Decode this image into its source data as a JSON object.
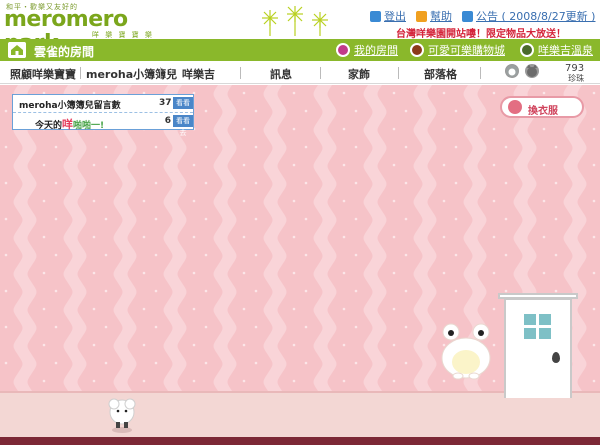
{
  "header": {
    "tagline": "和平・歡樂又友好的",
    "brand": "meromero park",
    "brand_sub": "咩 樂 寶 寶 樂 園",
    "links": [
      {
        "label": "登出",
        "icon": "logout-icon",
        "color": "#3a8ad4"
      },
      {
        "label": "幫助",
        "icon": "help-icon",
        "color": "#f0a020"
      },
      {
        "label": "公告 ( 2008/8/27更新 )",
        "icon": "notice-icon",
        "color": "#3a8ad4"
      }
    ],
    "promo": "台灣咩樂園開站嘍！限定物品大放送！"
  },
  "greenbar": {
    "title": "雲雀的房間",
    "links": [
      {
        "label": "我的房間",
        "icon": "my-room-icon",
        "color": "#c23a8a"
      },
      {
        "label": "可愛可樂購物城",
        "icon": "shopping-icon",
        "color": "#8b3a1a"
      },
      {
        "label": "咩樂吉溫泉",
        "icon": "hot-spring-icon",
        "color": "#4a6a2a"
      }
    ]
  },
  "nav": {
    "items": [
      "照顧咩樂寶寶",
      "meroha小簿簿兒",
      "咩樂吉",
      "訊息",
      "家飾",
      "部落格"
    ],
    "coins_value": "793",
    "coins_label": "珍珠"
  },
  "infobox": {
    "row1_label": "meroha小簿簿兒留言數",
    "row1_value": "37",
    "row1_button": "看看去",
    "row2_prefix": "今天的",
    "row2_highlight": "咩",
    "row2_suffix": "啪啪一!",
    "row2_value": "6",
    "row2_button": "看看去"
  },
  "wardrobe_button": "換衣服",
  "colors": {
    "brand_green": "#8ab82b",
    "wall_pink": "#f6c3c8",
    "promo_red": "#d4243a",
    "link_blue": "#3a6fb0"
  }
}
